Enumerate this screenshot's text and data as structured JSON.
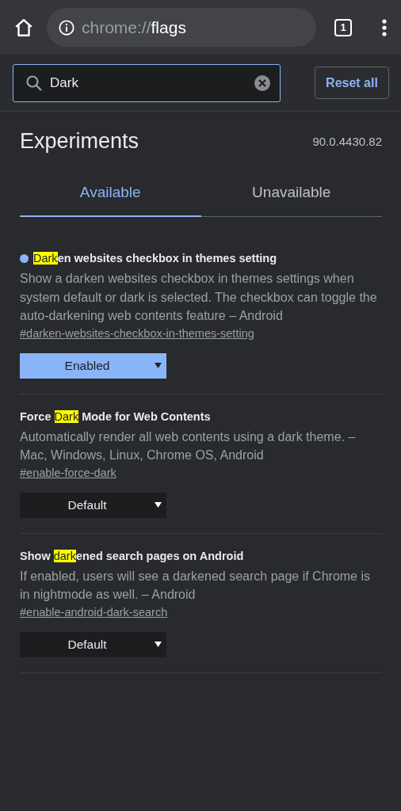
{
  "toolbar": {
    "scheme": "chrome://",
    "host": "flags",
    "tab_count": "1"
  },
  "search": {
    "value": "Dark"
  },
  "reset_button": "Reset all",
  "title": "Experiments",
  "version": "90.0.4430.82",
  "tabs": [
    {
      "label": "Available",
      "selected": true
    },
    {
      "label": "Unavailable",
      "selected": false
    }
  ],
  "flags": [
    {
      "modified": true,
      "title_match": "Dark",
      "title_after": "en websites checkbox in themes setting",
      "description": "Show a darken websites checkbox in themes settings when system default or dark is selected. The checkbox can toggle the auto-darkening web contents feature – Android",
      "link": "#darken-websites-checkbox-in-themes-setting",
      "value": "Enabled"
    },
    {
      "modified": false,
      "title_before": "Force ",
      "title_match": "Dark",
      "title_after": " Mode for Web Contents",
      "description": "Automatically render all web contents using a dark theme. – Mac, Windows, Linux, Chrome OS, Android",
      "link": "#enable-force-dark",
      "value": "Default"
    },
    {
      "modified": false,
      "title_before": "Show ",
      "title_match": "dark",
      "title_after": "ened search pages on Android",
      "description": "If enabled, users will see a darkened search page if Chrome is in nightmode as well. – Android",
      "link": "#enable-android-dark-search",
      "value": "Default"
    }
  ]
}
